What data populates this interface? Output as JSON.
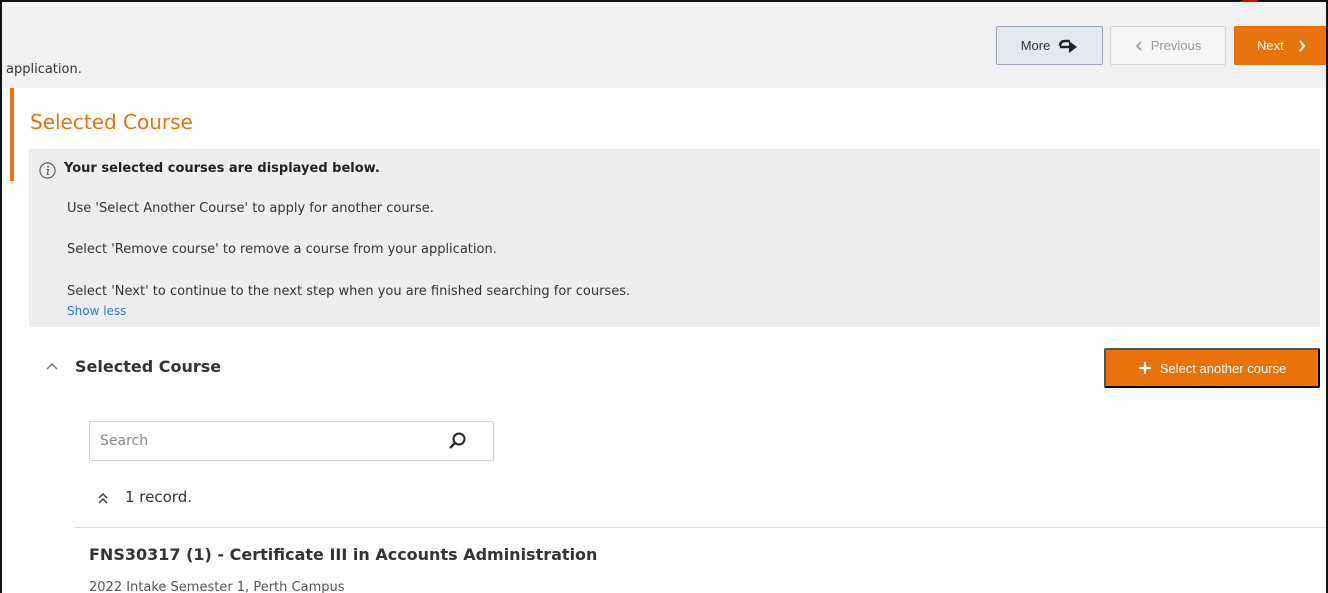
{
  "header": {
    "app_text": "application.",
    "more_label": "More",
    "previous_label": "Previous",
    "next_label": "Next"
  },
  "section": {
    "title": "Selected Course"
  },
  "info": {
    "heading": "Your selected courses are displayed below.",
    "lines": [
      "Use 'Select Another Course' to apply for another course.",
      "Select 'Remove course' to remove a course from your application.",
      "Select 'Next' to continue to the next step when you are finished searching for courses."
    ],
    "show_less": "Show less"
  },
  "subsection": {
    "title": "Selected Course",
    "select_button_label": "Select another course"
  },
  "search": {
    "placeholder": "Search",
    "value": ""
  },
  "records": {
    "count_text": "1 record."
  },
  "course": {
    "title": "FNS30317 (1) - Certificate III in Accounts Administration",
    "meta": "2022 Intake Semester 1, Perth Campus"
  },
  "colors": {
    "accent": "#e8730c",
    "link": "#2a7bd6",
    "panel": "#eeeef0",
    "annotation_arrow": "#c0141a"
  },
  "icons": {
    "more": "arrow-forward-icon",
    "previous": "chevron-left-icon",
    "next": "chevron-right-icon",
    "info": "info-icon",
    "collapse": "chevron-up-icon",
    "add": "plus-icon",
    "search": "search-icon",
    "records": "double-chevron-up-icon"
  }
}
